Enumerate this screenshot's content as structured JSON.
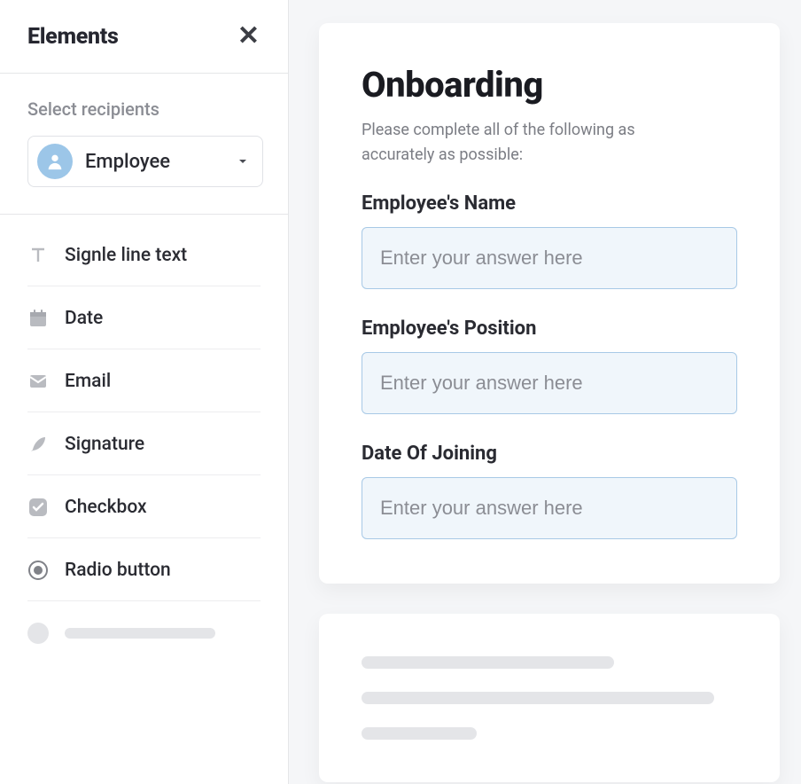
{
  "sidebar": {
    "title": "Elements",
    "recipients_label": "Select recipients",
    "selected_recipient": "Employee",
    "elements": [
      {
        "icon": "text-icon",
        "label": "Signle line text"
      },
      {
        "icon": "calendar-icon",
        "label": "Date"
      },
      {
        "icon": "mail-icon",
        "label": "Email"
      },
      {
        "icon": "feather-icon",
        "label": "Signature"
      },
      {
        "icon": "checkbox-icon",
        "label": "Checkbox"
      },
      {
        "icon": "radio-icon",
        "label": "Radio button"
      }
    ]
  },
  "form": {
    "title": "Onboarding",
    "description": "Please complete all of the following as accurately as possible:",
    "fields": [
      {
        "label": "Employee's Name",
        "placeholder": "Enter your answer here"
      },
      {
        "label": "Employee's Position",
        "placeholder": "Enter your answer here"
      },
      {
        "label": "Date Of Joining",
        "placeholder": "Enter your answer here"
      }
    ]
  },
  "colors": {
    "accent_bg": "#f0f6fb",
    "accent_border": "#a8c9e6",
    "avatar_bg": "#9cc6e8"
  }
}
